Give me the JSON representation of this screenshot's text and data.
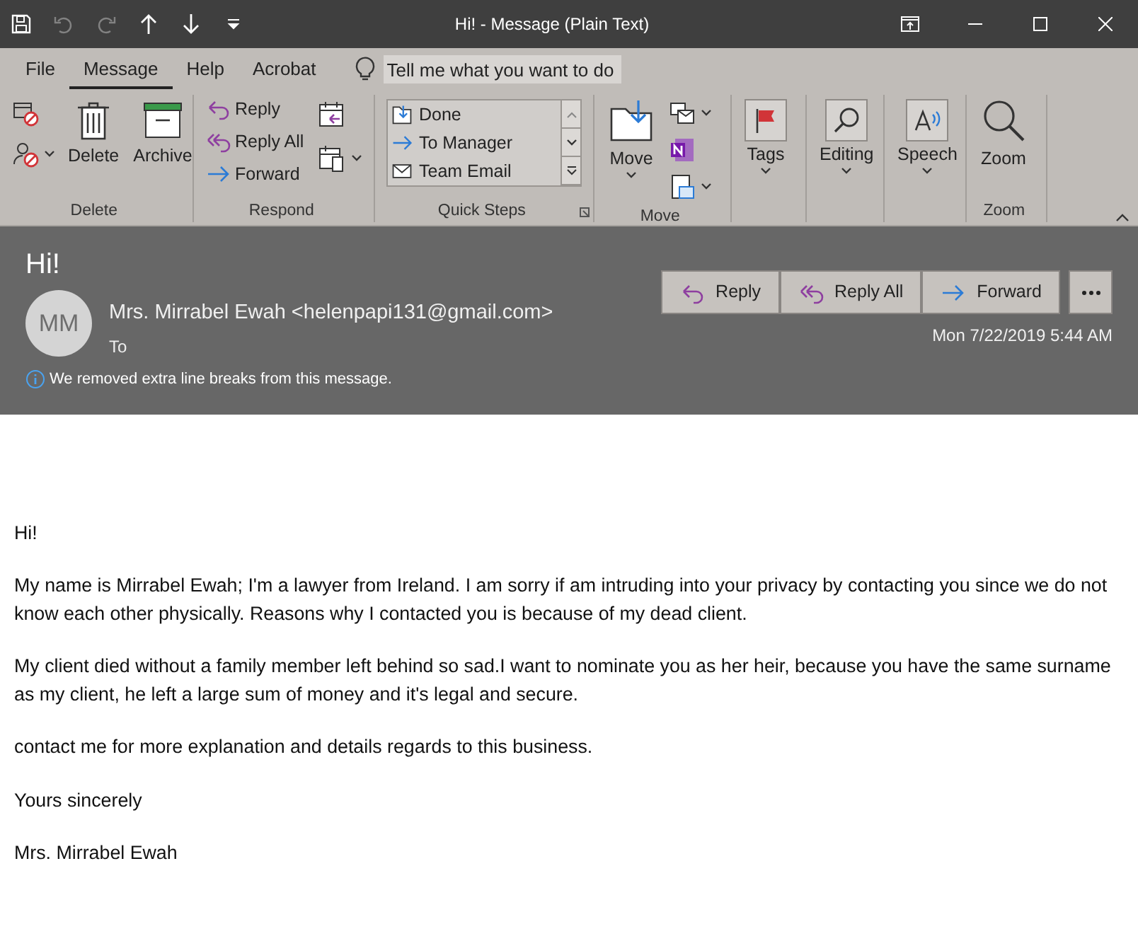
{
  "title_bar": {
    "title": "Hi!  -  Message (Plain Text)",
    "quick_access": [
      {
        "kind": "save",
        "disabled": false
      },
      {
        "kind": "undo",
        "disabled": true
      },
      {
        "kind": "redo",
        "disabled": true
      },
      {
        "kind": "up",
        "disabled": false
      },
      {
        "kind": "down",
        "disabled": false
      },
      {
        "kind": "customize",
        "disabled": false
      }
    ]
  },
  "menu_tabs": [
    {
      "label": "File",
      "selected": false
    },
    {
      "label": "Message",
      "selected": true
    },
    {
      "label": "Help",
      "selected": false
    },
    {
      "label": "Acrobat",
      "selected": false
    }
  ],
  "tell_me": {
    "placeholder": "Tell me what you want to do"
  },
  "ribbon_groups": [
    {
      "label": "Delete",
      "columns": [
        [
          {
            "kind": "ignore",
            "dropdown": false
          },
          {
            "kind": "junk",
            "dropdown": true
          }
        ],
        [
          {
            "kind": "delete",
            "label": "Delete",
            "dropdown": false
          }
        ],
        [
          {
            "kind": "archive",
            "label": "Archive",
            "dropdown": false
          }
        ]
      ]
    },
    {
      "label": "Respond",
      "columns": [
        [
          {
            "kind": "reply",
            "label": "Reply",
            "dropdown": false
          },
          {
            "kind": "replyall",
            "label": "Reply All",
            "dropdown": false
          },
          {
            "kind": "forward",
            "label": "Forward",
            "dropdown": false
          }
        ],
        [
          {
            "kind": "meeting",
            "dropdown": false
          },
          {
            "kind": "more",
            "dropdown": true
          }
        ]
      ]
    },
    {
      "label": "Quick Steps",
      "gallery": [
        {
          "kind": "done",
          "label": "Done"
        },
        {
          "kind": "forward",
          "label": "To Manager"
        },
        {
          "kind": "mail",
          "label": "Team Email"
        }
      ]
    },
    {
      "label": "Move",
      "columns": [
        [
          {
            "kind": "move",
            "label": "Move",
            "dropdown": true
          }
        ],
        [
          {
            "kind": "rules",
            "dropdown": true
          },
          {
            "kind": "onenote",
            "dropdown": false
          },
          {
            "kind": "actions",
            "dropdown": true
          }
        ]
      ]
    },
    {
      "columns": [
        [
          {
            "kind": "tags",
            "label": "Tags",
            "dropdown": true
          }
        ]
      ]
    },
    {
      "columns": [
        [
          {
            "kind": "editing",
            "label": "Editing",
            "dropdown": true
          }
        ]
      ]
    },
    {
      "columns": [
        [
          {
            "kind": "speech",
            "label": "Speech",
            "dropdown": true
          }
        ]
      ]
    },
    {
      "label": "Zoom",
      "columns": [
        [
          {
            "kind": "zoom",
            "label": "Zoom",
            "dropdown": false
          }
        ]
      ]
    }
  ],
  "message": {
    "subject": "Hi!",
    "avatar_initials": "MM",
    "sender": "Mrs. Mirrabel Ewah <helenpapi131@gmail.com>",
    "to_label": "To",
    "actions": [
      {
        "kind": "reply",
        "label": "Reply"
      },
      {
        "kind": "replyall",
        "label": "Reply All"
      },
      {
        "kind": "forward",
        "label": "Forward"
      }
    ],
    "date": "Mon 7/22/2019 5:44 AM",
    "notice": "We removed extra line breaks from this message."
  },
  "body": [
    "Hi!",
    "My name is Mirrabel Ewah; I'm a lawyer from Ireland. I am sorry if am intruding into your privacy by contacting you since we do not know each other physically. Reasons why I contacted you is because of my dead client.",
    "My client died without a family member left behind so sad.I want to nominate you as her heir, because you have the same surname as my client, he left a large sum of money and it's legal and secure.",
    "contact me for more explanation and details regards to this business.",
    "Yours sincerely",
    "Mrs. Mirrabel Ewah"
  ]
}
